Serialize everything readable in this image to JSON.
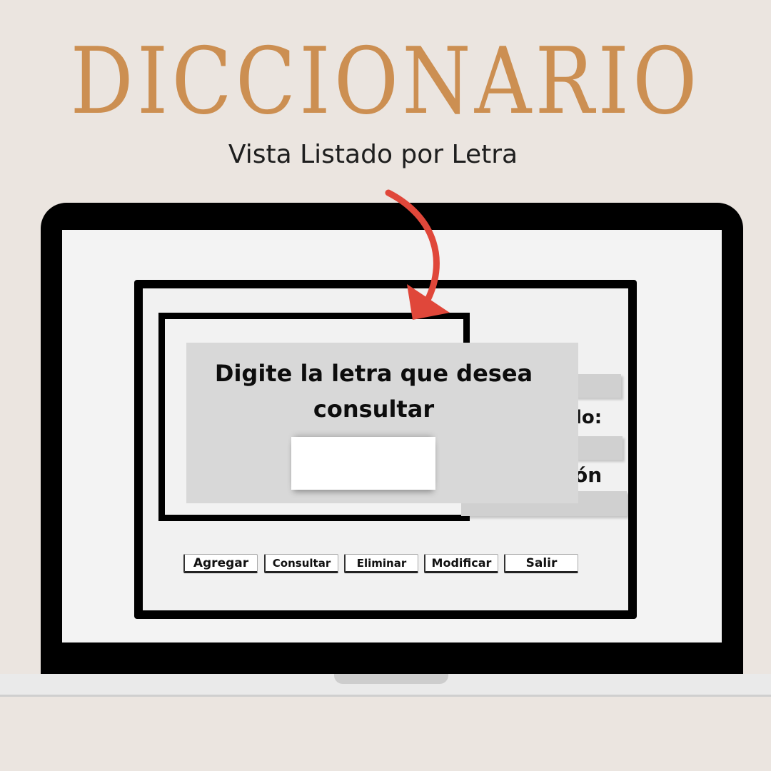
{
  "header": {
    "title": "DICCIONARIO",
    "subtitle": "Vista Listado por Letra"
  },
  "dialog": {
    "prompt_line1": "Digite la letra que desea",
    "prompt_line2": "consultar",
    "input_value": ""
  },
  "form": {
    "label_partial_1": "lo:",
    "label_partial_2": "ón"
  },
  "buttons": {
    "add": "Agregar",
    "query": "Consultar",
    "delete": "Eliminar",
    "modify": "Modificar",
    "exit": "Salir"
  },
  "colors": {
    "title": "#cc8f52",
    "arrow": "#e0473a",
    "background": "#ebe5e0"
  }
}
